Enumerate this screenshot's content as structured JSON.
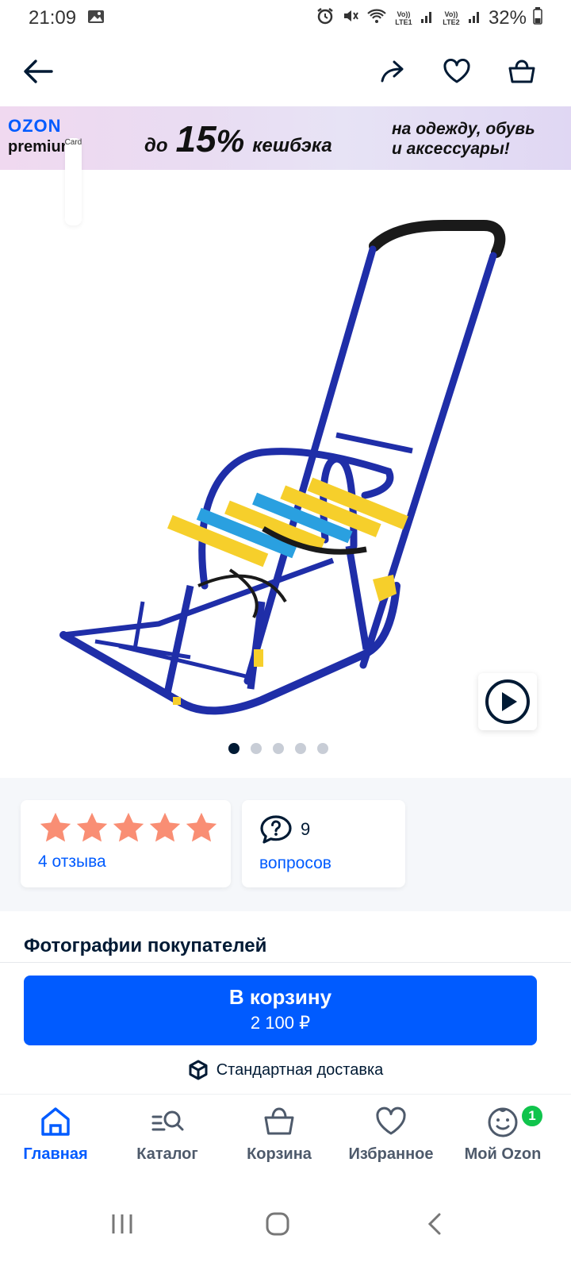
{
  "status": {
    "time": "21:09",
    "battery": "32%",
    "lte1": "Vo)) LTE1",
    "lte2": "Vo)) LTE2"
  },
  "banner": {
    "brand": "OZON",
    "card": "Card",
    "premium": "premium",
    "promo_prefix": "до",
    "promo_number": "15",
    "promo_pct": "%",
    "promo_suffix": "кешбэка",
    "note_line1": "на одежду, обувь",
    "note_line2": "и аксессуары!"
  },
  "gallery": {
    "total": 5,
    "active": 1
  },
  "rating": {
    "stars": 5,
    "reviews_link": "4 отзыва",
    "star_color": "#f98e74"
  },
  "questions": {
    "count": "9",
    "link": "вопросов"
  },
  "section": {
    "title": "Фотографии покупателей"
  },
  "cart": {
    "button_label": "В корзину",
    "price": "2 100 ₽",
    "delivery": "Стандартная доставка"
  },
  "nav": [
    {
      "label": "Главная",
      "icon": "home-icon",
      "active": true
    },
    {
      "label": "Каталог",
      "icon": "catalog-search-icon",
      "active": false
    },
    {
      "label": "Корзина",
      "icon": "basket-icon",
      "active": false
    },
    {
      "label": "Избранное",
      "icon": "heart-icon",
      "active": false
    },
    {
      "label": "Мой Ozon",
      "icon": "profile-smile-icon",
      "active": false,
      "badge": "1"
    }
  ],
  "colors": {
    "accent": "#005bff",
    "text": "#001a34",
    "badge": "#10c44c",
    "sled": "#1f2ea8",
    "slat_yellow": "#f6cf2b",
    "slat_blue": "#2aa0e0"
  }
}
